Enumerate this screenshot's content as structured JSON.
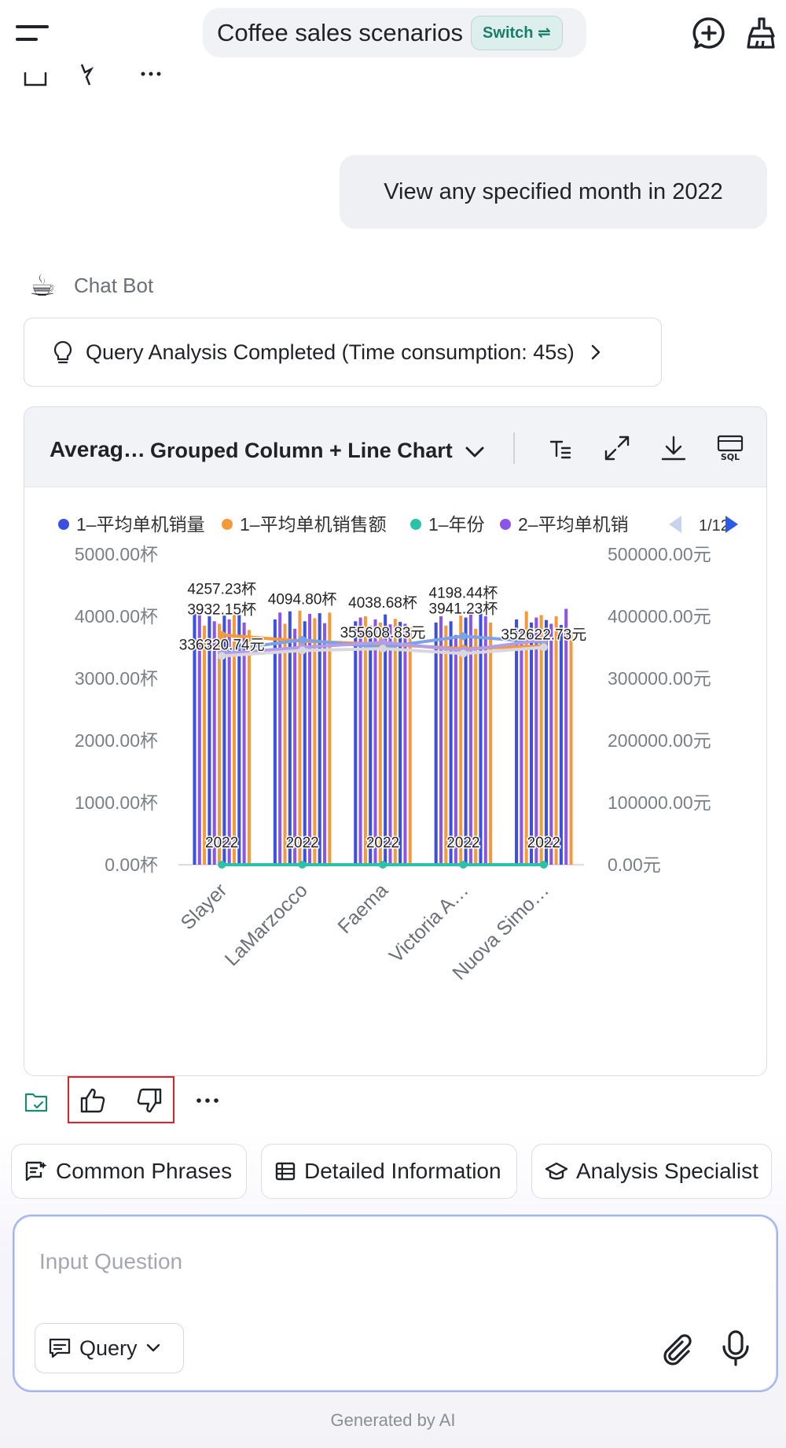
{
  "header": {
    "title": "Coffee sales scenarios",
    "switch_label": "Switch ⇌"
  },
  "conversation": {
    "user_message": "View any specified month in 2022",
    "bot_name": "Chat Bot",
    "bot_avatar": "☕",
    "analysis_status": "Query Analysis Completed (Time consumption: 45s)"
  },
  "chart_card": {
    "title_truncated": "Averag…",
    "chart_type_label": "Grouped Column + Line Chart",
    "tools": [
      "text-format-icon",
      "expand-icon",
      "download-icon",
      "sql-icon"
    ],
    "sql_label": "SQL",
    "legend_page": "1/12"
  },
  "chart_data": {
    "type": "bar",
    "categories": [
      "Slayer",
      "LaMarzocco",
      "Faema",
      "Victoria A…",
      "Nuova Simo…"
    ],
    "legend": [
      "1–平均单机销量",
      "1–平均单机销售额",
      "1–年份",
      "2–平均单机销"
    ],
    "legend_colors": [
      "#3b4fe0",
      "#f59a3c",
      "#2cc2a8",
      "#8b55e6"
    ],
    "y_left": {
      "ticks": [
        "5000.00杯",
        "4000.00杯",
        "3000.00杯",
        "2000.00杯",
        "1000.00杯",
        "0.00杯"
      ],
      "range": [
        0,
        5000
      ]
    },
    "y_right": {
      "ticks": [
        "500000.00元",
        "400000.00元",
        "300000.00元",
        "200000.00元",
        "100000.00元",
        "0.00元"
      ],
      "range": [
        0,
        500000
      ]
    },
    "bar_groups": [
      [
        4100,
        4050,
        3850,
        4000,
        3920,
        3880,
        4010,
        3950,
        4100,
        4020,
        3900,
        3780
      ],
      [
        3950,
        4060,
        3880,
        4080,
        3800,
        4090,
        3920,
        4040,
        3970,
        4050,
        3890,
        4060
      ],
      [
        3920,
        3980,
        4000,
        3850,
        3950,
        3900,
        4030,
        3870,
        3960,
        3910,
        3880,
        3820
      ],
      [
        3900,
        4000,
        3850,
        3920,
        3700,
        4010,
        3980,
        4120,
        3800,
        4150,
        4000,
        3900
      ],
      [
        3950,
        3800,
        4080,
        3900,
        3980,
        4020,
        3940,
        3880,
        4000,
        3860,
        4120,
        3760
      ]
    ],
    "bar_colors": [
      "#3b4fe0",
      "#8b55e6",
      "#f59a3c"
    ],
    "data_labels": [
      {
        "text": "4257.23杯",
        "cat": 0,
        "y": 4257.23
      },
      {
        "text": "3932.15杯",
        "cat": 0,
        "y": 3932.15
      },
      {
        "text": "336320.74元",
        "cat": 0,
        "y": 3363.2
      },
      {
        "text": "4094.80杯",
        "cat": 1,
        "y": 4094.8
      },
      {
        "text": "4038.68杯",
        "cat": 2,
        "y": 4038.68
      },
      {
        "text": "355608.83元",
        "cat": 2,
        "y": 3556.1
      },
      {
        "text": "4198.44杯",
        "cat": 3,
        "y": 4198.44
      },
      {
        "text": "3941.23杯",
        "cat": 3,
        "y": 3941.23
      },
      {
        "text": "352622.73元",
        "cat": 4,
        "y": 3526.2
      }
    ],
    "year_labels": [
      "2022",
      "2022",
      "2022",
      "2022",
      "2022"
    ],
    "lines": [
      {
        "color": "#f59a3c",
        "values": [
          370000,
          360000,
          355000,
          348000,
          352000
        ]
      },
      {
        "color": "#7aa2e6",
        "values": [
          345000,
          362000,
          350000,
          368000,
          358000
        ]
      },
      {
        "color": "#b39ce8",
        "values": [
          340000,
          350000,
          358000,
          345000,
          362000
        ]
      },
      {
        "color": "#d8d8dc",
        "values": [
          336000,
          345000,
          348000,
          340000,
          350000
        ]
      },
      {
        "color": "#2cc2a8",
        "values": [
          0,
          0,
          0,
          0,
          0
        ]
      }
    ]
  },
  "feedback": {
    "collect": "collect-icon",
    "like": "thumbs-up-icon",
    "dislike": "thumbs-down-icon",
    "more": "more-icon"
  },
  "quick_actions": [
    {
      "label": "Common Phrases",
      "icon": "phrases-icon"
    },
    {
      "label": "Detailed Information",
      "icon": "table-icon"
    },
    {
      "label": "Analysis Specialist",
      "icon": "graduation-cap-icon"
    }
  ],
  "composer": {
    "placeholder": "Input Question",
    "mode_label": "Query"
  },
  "footer_note": "Generated by AI"
}
